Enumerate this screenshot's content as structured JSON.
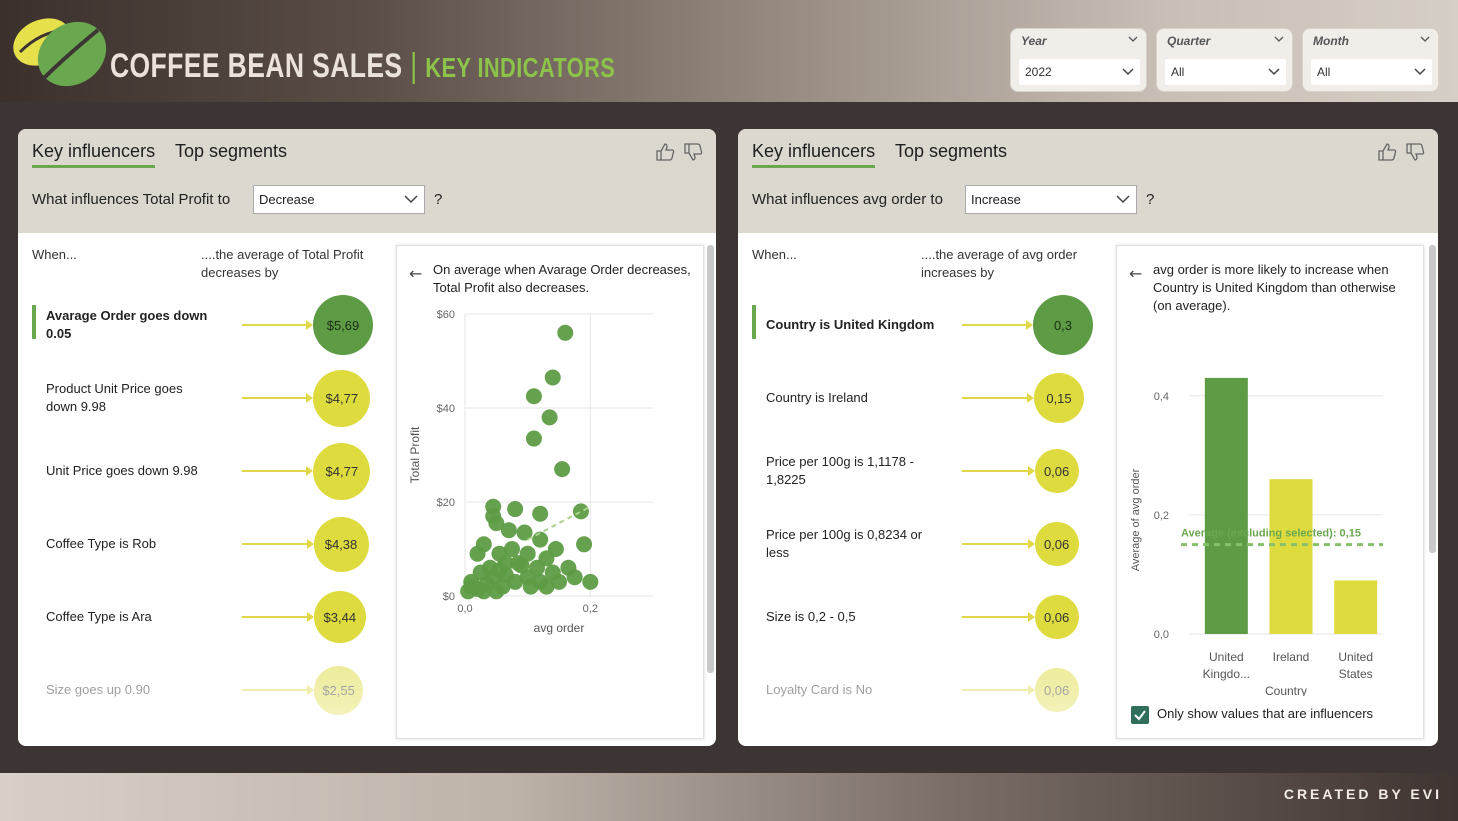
{
  "header": {
    "brand_title": "COFFEE BEAN SALES",
    "brand_separator": "|",
    "brand_subtitle": "KEY INDICATORS",
    "logo_icon": "coffee-bean-logo-icon",
    "colors": {
      "accent_green": "#6aa84f",
      "bubble_dark": "#5d9c45",
      "bubble_yellow": "#dedb3f"
    }
  },
  "slicers": [
    {
      "label": "Year",
      "value": "2022"
    },
    {
      "label": "Quarter",
      "value": "All"
    },
    {
      "label": "Month",
      "value": "All"
    }
  ],
  "footer": {
    "credits": "CREATED BY EVI"
  },
  "left": {
    "tabs": [
      "Key influencers",
      "Top segments"
    ],
    "question_prefix": "What influences Total Profit to",
    "dropdown_value": "Decrease",
    "question_mark": "?",
    "col_when": "When...",
    "col_effect": "....the average of Total Profit decreases by",
    "influencers": [
      {
        "text": "Avarage Order goes down 0.05",
        "value": "$5,69"
      },
      {
        "text": "Product Unit Price goes down 9.98",
        "value": "$4,77"
      },
      {
        "text": "Unit Price goes down 9.98",
        "value": "$4,77"
      },
      {
        "text": "Coffee Type is Rob",
        "value": "$4,38"
      },
      {
        "text": "Coffee Type is Ara",
        "value": "$3,44"
      },
      {
        "text": "Size goes up 0.90",
        "value": "$2,55"
      }
    ],
    "detail_text": "On average when Avarage Order decreases, Total Profit also decreases.",
    "chart_data": {
      "type": "scatter",
      "xlabel": "avg order",
      "ylabel": "Total Profit",
      "xlim": [
        0,
        0.3
      ],
      "ylim": [
        0,
        60
      ],
      "x_ticks": [
        "0,0",
        "0,2"
      ],
      "y_ticks": [
        "$0",
        "$20",
        "$40",
        "$60"
      ],
      "trend": {
        "x": [
          0.1,
          0.2
        ],
        "y": [
          12,
          19
        ]
      },
      "points": [
        [
          0.16,
          56
        ],
        [
          0.14,
          46.5
        ],
        [
          0.11,
          42.5
        ],
        [
          0.135,
          38
        ],
        [
          0.11,
          33.5
        ],
        [
          0.155,
          27
        ],
        [
          0.045,
          19
        ],
        [
          0.08,
          18.5
        ],
        [
          0.12,
          17.5
        ],
        [
          0.185,
          18
        ],
        [
          0.045,
          17
        ],
        [
          0.05,
          15.5
        ],
        [
          0.07,
          14
        ],
        [
          0.095,
          13.5
        ],
        [
          0.12,
          12
        ],
        [
          0.19,
          11
        ],
        [
          0.03,
          11
        ],
        [
          0.075,
          10
        ],
        [
          0.145,
          10
        ],
        [
          0.02,
          9
        ],
        [
          0.055,
          9
        ],
        [
          0.1,
          9
        ],
        [
          0.13,
          8
        ],
        [
          0.165,
          6
        ],
        [
          0.04,
          6
        ],
        [
          0.065,
          7
        ],
        [
          0.09,
          6.5
        ],
        [
          0.115,
          6
        ],
        [
          0.14,
          5
        ],
        [
          0.175,
          4
        ],
        [
          0.2,
          3
        ],
        [
          0.01,
          3
        ],
        [
          0.025,
          5
        ],
        [
          0.045,
          4
        ],
        [
          0.06,
          2
        ],
        [
          0.08,
          3
        ],
        [
          0.1,
          4
        ],
        [
          0.12,
          3
        ],
        [
          0.005,
          1
        ],
        [
          0.02,
          1.5
        ],
        [
          0.035,
          2.5
        ],
        [
          0.05,
          1
        ],
        [
          0.065,
          4.5
        ],
        [
          0.085,
          7
        ],
        [
          0.105,
          2
        ],
        [
          0.13,
          2
        ],
        [
          0.15,
          3
        ],
        [
          0.01,
          2
        ],
        [
          0.03,
          1
        ],
        [
          0.055,
          5.5
        ]
      ]
    }
  },
  "right": {
    "tabs": [
      "Key influencers",
      "Top segments"
    ],
    "question_prefix": "What influences avg order to",
    "dropdown_value": "Increase",
    "question_mark": "?",
    "col_when": "When...",
    "col_effect": "....the average of avg order increases by",
    "influencers": [
      {
        "text": "Country is United Kingdom",
        "value": "0,3"
      },
      {
        "text": "Country is Ireland",
        "value": "0,15"
      },
      {
        "text": "Price per 100g is 1,1178 - 1,8225",
        "value": "0,06"
      },
      {
        "text": "Price per 100g is 0,8234 or less",
        "value": "0,06"
      },
      {
        "text": "Size is 0,2 - 0,5",
        "value": "0,06"
      },
      {
        "text": "Loyalty Card is No",
        "value": "0,06"
      }
    ],
    "detail_text": "avg order is more likely to increase when Country is United Kingdom than otherwise (on average).",
    "chart_data": {
      "type": "bar",
      "categories": [
        "United Kingdo...",
        "Ireland",
        "United States"
      ],
      "values": [
        0.43,
        0.26,
        0.09
      ],
      "xlabel": "Country",
      "ylabel": "Average of avg order",
      "ylim": [
        0,
        0.45
      ],
      "y_ticks": [
        "0,0",
        "0,2",
        "0,4"
      ],
      "reference_value": 0.15,
      "reference_label": "Average (excluding selected): 0,15",
      "bar_colors": [
        "#5d9c45",
        "#dedb3f",
        "#dedb3f"
      ]
    },
    "checkbox_label": "Only show values that are influencers",
    "checkbox_checked": true
  },
  "icons": [
    "thumbs-up-icon",
    "thumbs-down-icon",
    "chevron-down-icon",
    "back-arrow-icon",
    "checkmark-icon"
  ]
}
